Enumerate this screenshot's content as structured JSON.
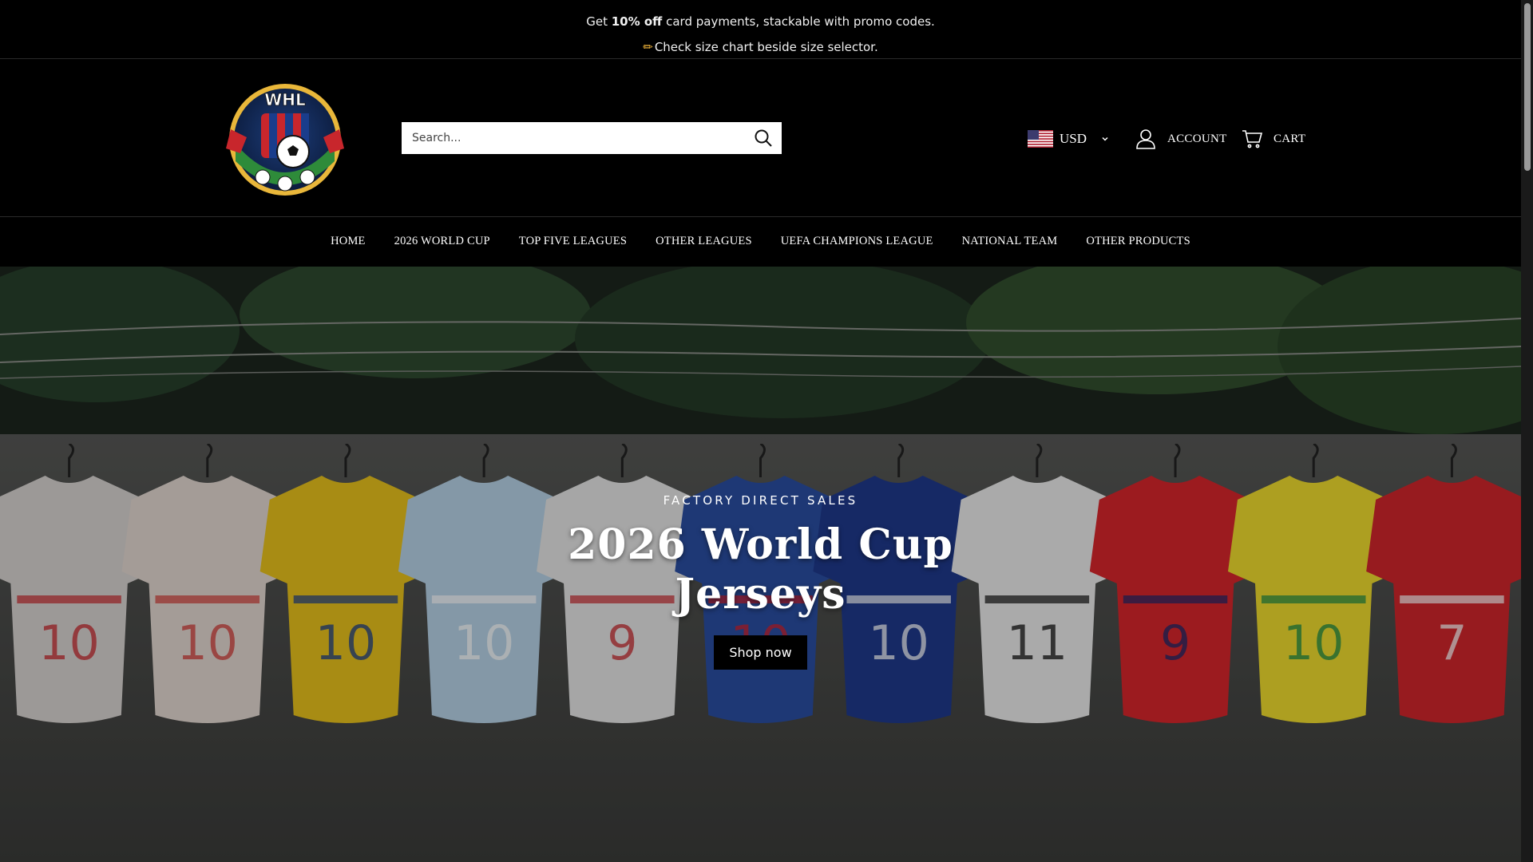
{
  "announcement": {
    "line1_prefix": "Get ",
    "line1_bold": "10% off",
    "line1_suffix": " card payments, stackable with promo codes.",
    "line2": "Check size chart beside size selector."
  },
  "header": {
    "logo_text": "WHL",
    "search": {
      "placeholder": "Search..."
    },
    "currency": {
      "code": "USD"
    },
    "account_label": "ACCOUNT",
    "cart_label": "CART"
  },
  "nav": {
    "items": [
      "HOME",
      "2026 WORLD CUP",
      "TOP FIVE LEAGUES",
      "OTHER LEAGUES",
      "UEFA CHAMPIONS LEAGUE",
      "NATIONAL TEAM",
      "OTHER PRODUCTS"
    ]
  },
  "hero": {
    "eyebrow": "FACTORY DIRECT SALES",
    "headline_line1": "2026 World Cup",
    "headline_line2": "Jerseys",
    "cta_label": "Shop now"
  },
  "jerseys": [
    {
      "color": "#d9d4d2",
      "accent": "#c8262c",
      "number": "10"
    },
    {
      "color": "#e4d9d2",
      "accent": "#d23a36",
      "number": "10"
    },
    {
      "color": "#e9c31c",
      "accent": "#1a3d8c",
      "number": "10"
    },
    {
      "color": "#b7d3e8",
      "accent": "#ffffff",
      "number": "10"
    },
    {
      "color": "#e6e6e6",
      "accent": "#c8262c",
      "number": "9"
    },
    {
      "color": "#2a4ea3",
      "accent": "#d7202b",
      "number": "10"
    },
    {
      "color": "#1f3a8c",
      "accent": "#ffffff",
      "number": "10"
    },
    {
      "color": "#ececec",
      "accent": "#111111",
      "number": "11"
    },
    {
      "color": "#d8262c",
      "accent": "#1a2a6c",
      "number": "9"
    },
    {
      "color": "#f0dd2e",
      "accent": "#1a8a47",
      "number": "10"
    },
    {
      "color": "#d2262c",
      "accent": "#ffffff",
      "number": "7"
    }
  ]
}
